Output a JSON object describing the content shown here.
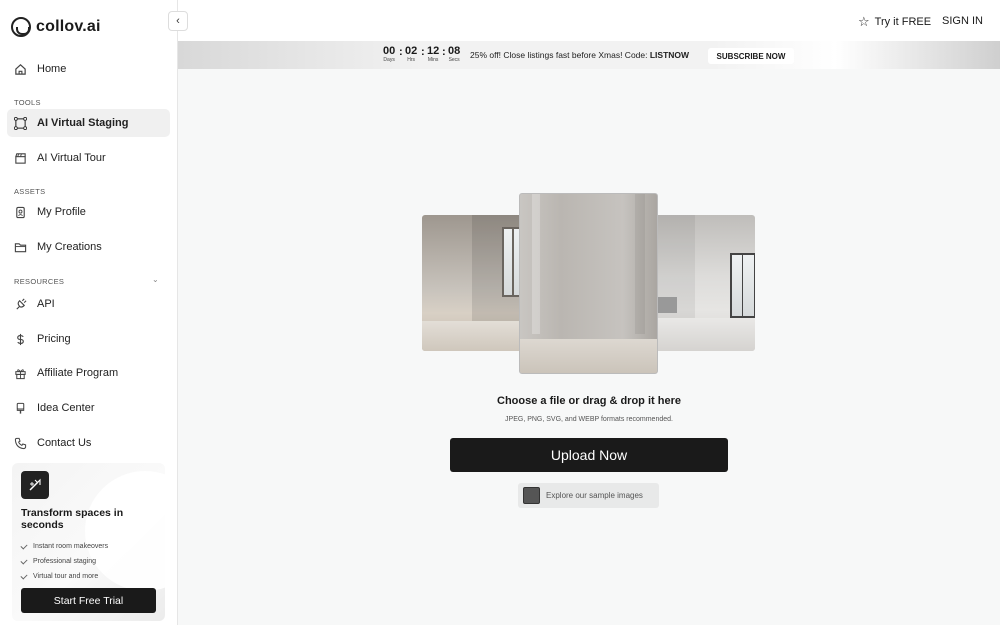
{
  "brand": {
    "name": "collov.ai"
  },
  "sidebar": {
    "collapse_icon": "chevron-left-icon",
    "home": {
      "label": "Home",
      "icon": "home-icon"
    },
    "sections": {
      "tools": "TOOLS",
      "assets": "ASSETS",
      "resources": "RESOURCES"
    },
    "tools": [
      {
        "label": "AI Virtual Staging",
        "icon": "staging-icon",
        "active": true
      },
      {
        "label": "AI Virtual Tour",
        "icon": "clapperboard-icon",
        "active": false
      }
    ],
    "assets": [
      {
        "label": "My Profile",
        "icon": "profile-icon"
      },
      {
        "label": "My Creations",
        "icon": "folder-icon"
      }
    ],
    "resources": [
      {
        "label": "API",
        "icon": "api-icon"
      },
      {
        "label": "Pricing",
        "icon": "dollar-icon"
      },
      {
        "label": "Affiliate Program",
        "icon": "gift-icon"
      },
      {
        "label": "Idea Center",
        "icon": "brush-icon"
      },
      {
        "label": "Contact Us",
        "icon": "phone-icon"
      }
    ],
    "promo": {
      "title": "Transform spaces in seconds",
      "features": [
        "Instant room makeovers",
        "Professional staging",
        "Virtual tour and more"
      ],
      "cta": "Start Free Trial"
    }
  },
  "header": {
    "try_free": "Try it FREE",
    "sign_in": "SIGN IN"
  },
  "banner": {
    "countdown": [
      {
        "value": "00",
        "unit": "Days"
      },
      {
        "value": "02",
        "unit": "Hrs"
      },
      {
        "value": "12",
        "unit": "Mins"
      },
      {
        "value": "08",
        "unit": "Secs"
      }
    ],
    "message": "25% off! Close listings fast before Xmas! Code: ",
    "code": "LISTNOW",
    "subscribe": "SUBSCRIBE NOW"
  },
  "upload": {
    "title": "Choose a file or drag & drop it here",
    "formats": "JPEG, PNG, SVG, and WEBP formats recommended.",
    "button": "Upload Now",
    "sample": "Explore our sample images"
  }
}
